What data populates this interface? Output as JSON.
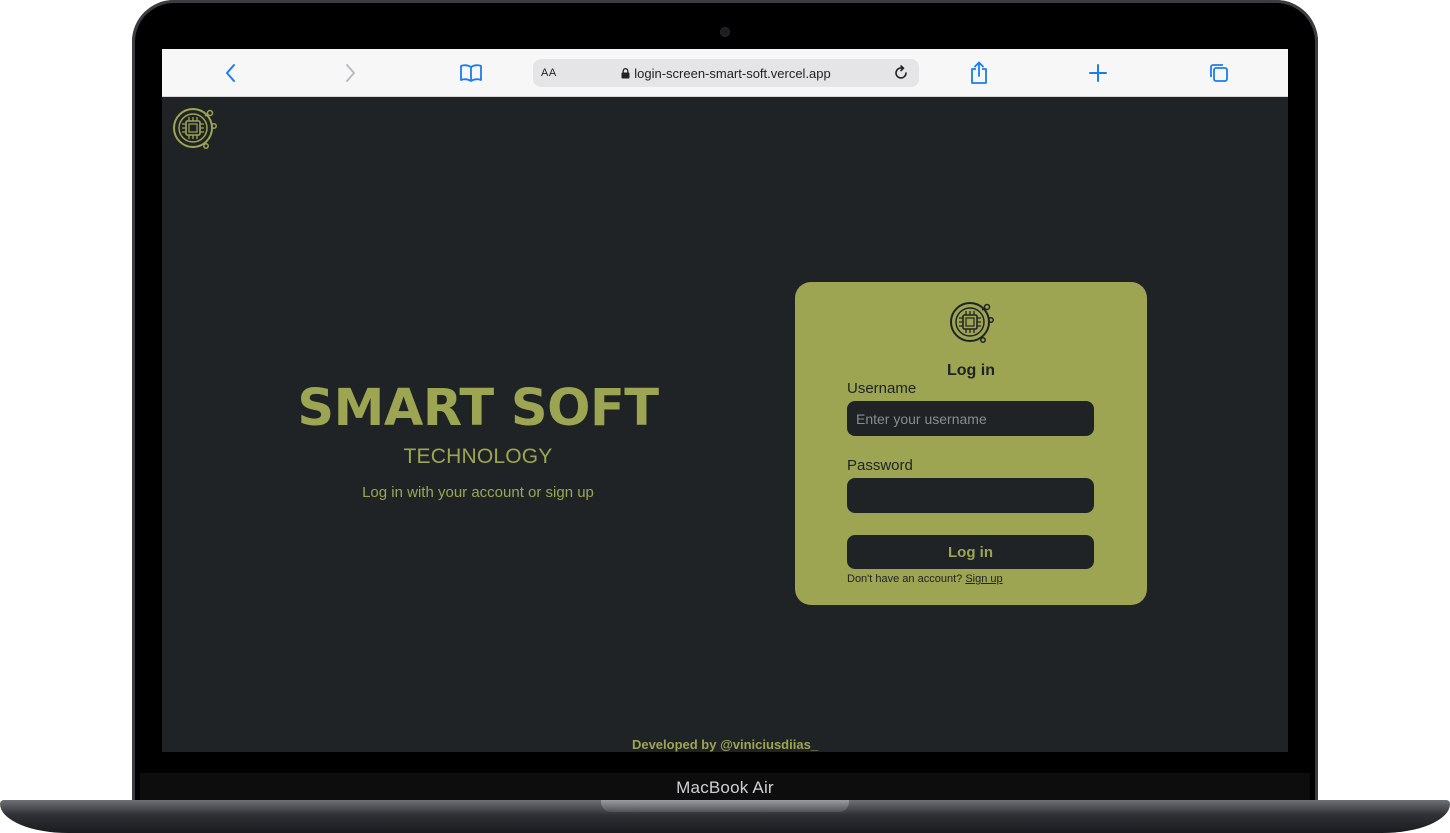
{
  "device": {
    "label": "MacBook Air"
  },
  "browser": {
    "address_prefix": "AA",
    "url": "login-screen-smart-soft.vercel.app",
    "icons": [
      "back-icon",
      "forward-icon",
      "bookmarks-icon",
      "lock-icon",
      "reload-icon",
      "share-icon",
      "new-tab-icon",
      "tabs-icon"
    ]
  },
  "page": {
    "hero": {
      "title": "SMART SOFT",
      "subtitle": "TECHNOLOGY",
      "tagline": "Log in with your account or sign up"
    },
    "login_card": {
      "title": "Log in",
      "username_label": "Username",
      "username_placeholder": "Enter your username",
      "password_label": "Password",
      "submit_label": "Log in",
      "signup_prompt": "Don't have an account?",
      "signup_link": "Sign up"
    },
    "footer": "Developed by @viniciusdiias_",
    "logo_icon": "circuit-chip-icon"
  },
  "colors": {
    "accent": "#9ca552",
    "background": "#202326",
    "toolbar": "#f7f7f7",
    "toolbar_icon": "#1a7cf0"
  }
}
